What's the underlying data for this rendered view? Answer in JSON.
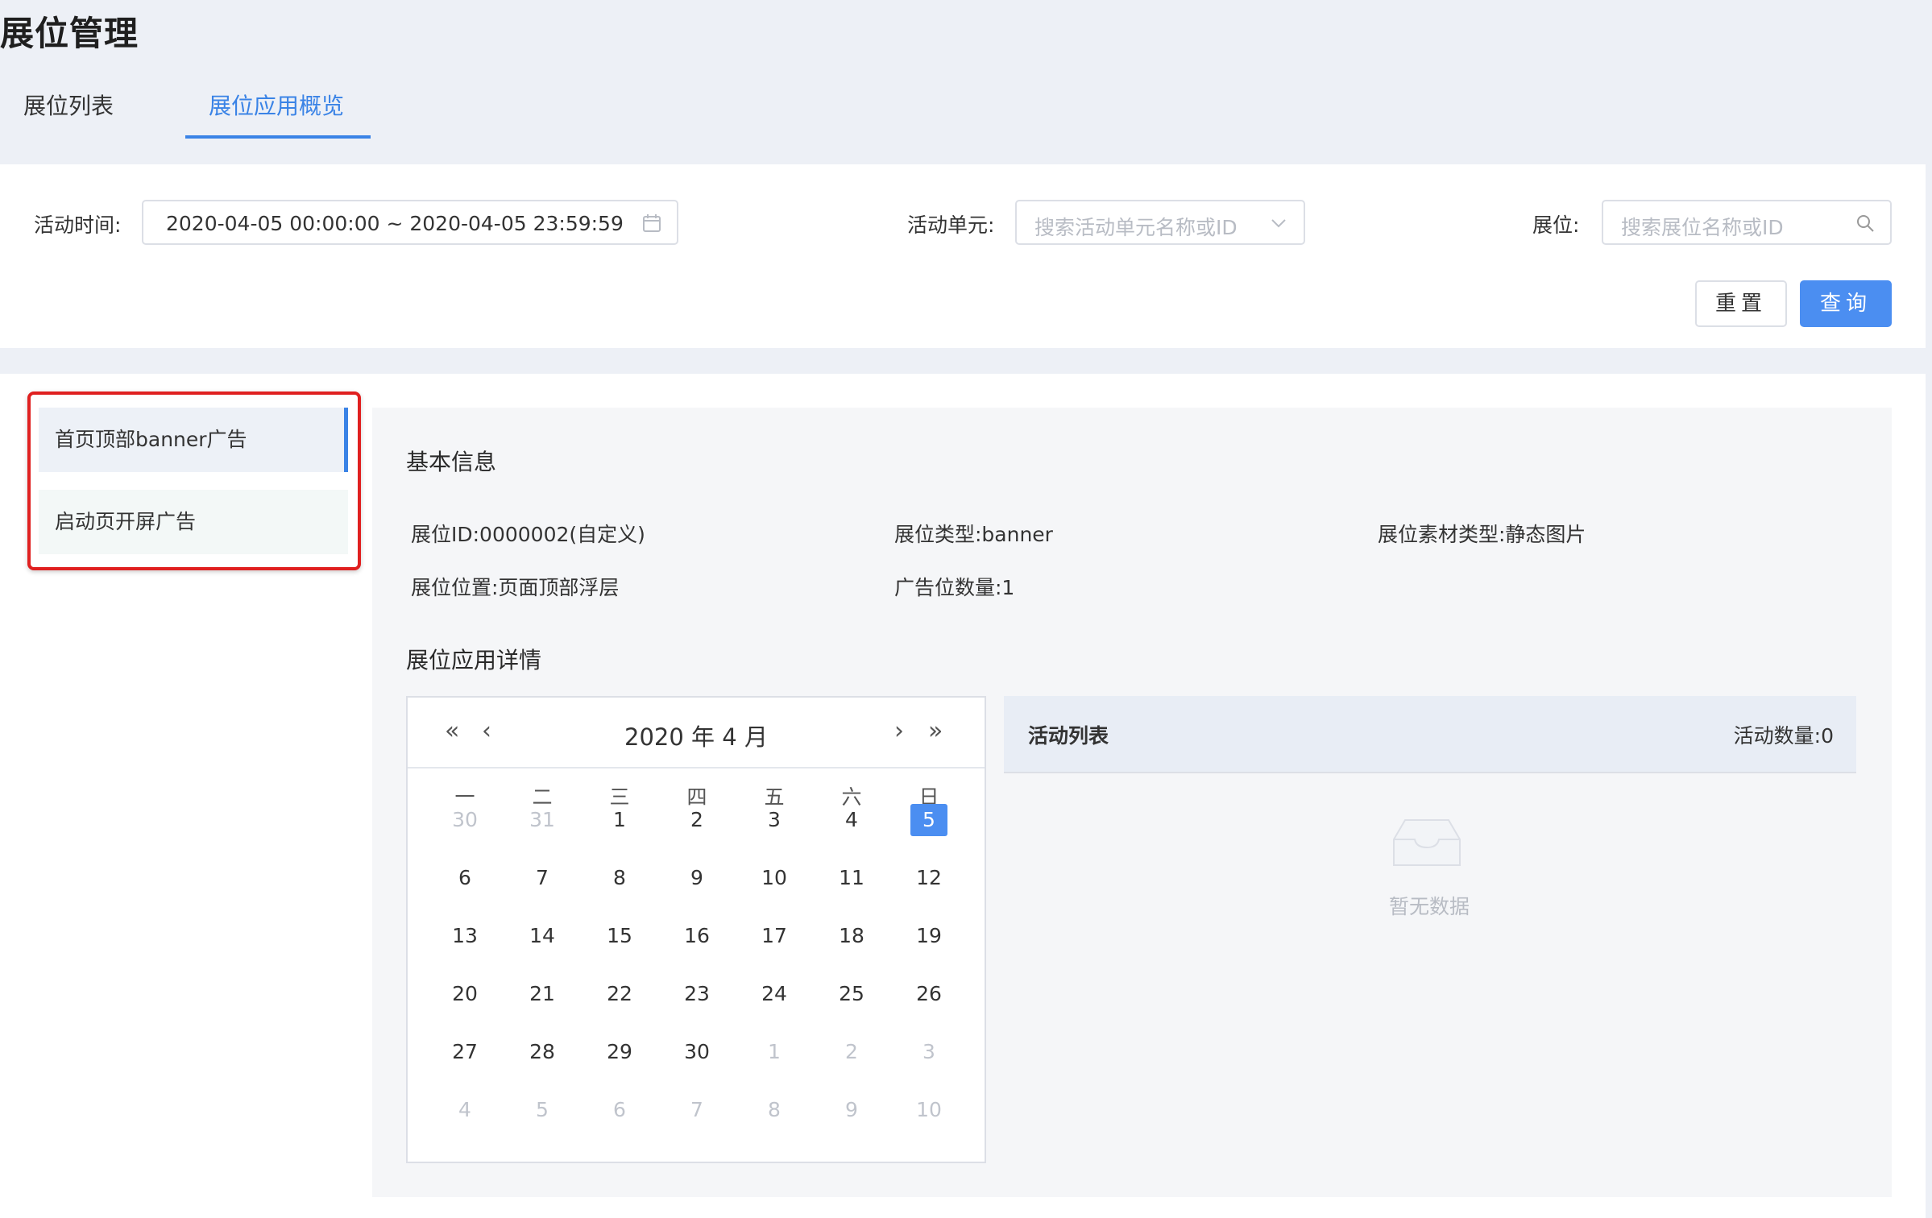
{
  "page": {
    "title": "展位管理"
  },
  "tabs": [
    {
      "label": "展位列表"
    },
    {
      "label": "展位应用概览"
    }
  ],
  "filters": {
    "time_label": "活动时间:",
    "time_value": "2020-04-05 00:00:00 ~ 2020-04-05 23:59:59",
    "unit_label": "活动单元:",
    "unit_placeholder": "搜索活动单元名称或ID",
    "slot_label": "展位:",
    "slot_placeholder": "搜索展位名称或ID",
    "reset_label": "重置",
    "query_label": "查询"
  },
  "slot_list": [
    {
      "label": "首页顶部banner广告"
    },
    {
      "label": "启动页开屏广告"
    }
  ],
  "basic_info": {
    "title": "基本信息",
    "id": "展位ID:0000002(自定义)",
    "type": "展位类型:banner",
    "material": "展位素材类型:静态图片",
    "position": "展位位置:页面顶部浮层",
    "count": "广告位数量:1"
  },
  "detail": {
    "title": "展位应用详情"
  },
  "calendar": {
    "title": "2020 年 4 月",
    "weekdays": [
      "一",
      "二",
      "三",
      "四",
      "五",
      "六",
      "日"
    ],
    "weeks": [
      [
        "30",
        "31",
        "1",
        "2",
        "3",
        "4",
        "5"
      ],
      [
        "6",
        "7",
        "8",
        "9",
        "10",
        "11",
        "12"
      ],
      [
        "13",
        "14",
        "15",
        "16",
        "17",
        "18",
        "19"
      ],
      [
        "20",
        "21",
        "22",
        "23",
        "24",
        "25",
        "26"
      ],
      [
        "27",
        "28",
        "29",
        "30",
        "1",
        "2",
        "3"
      ],
      [
        "4",
        "5",
        "6",
        "7",
        "8",
        "9",
        "10"
      ]
    ],
    "selected": "5"
  },
  "activity": {
    "title": "活动列表",
    "count": "活动数量:0",
    "empty_text": "暂无数据"
  },
  "colors": {
    "accent": "#4b8ef1",
    "highlight_border": "#e02020"
  }
}
